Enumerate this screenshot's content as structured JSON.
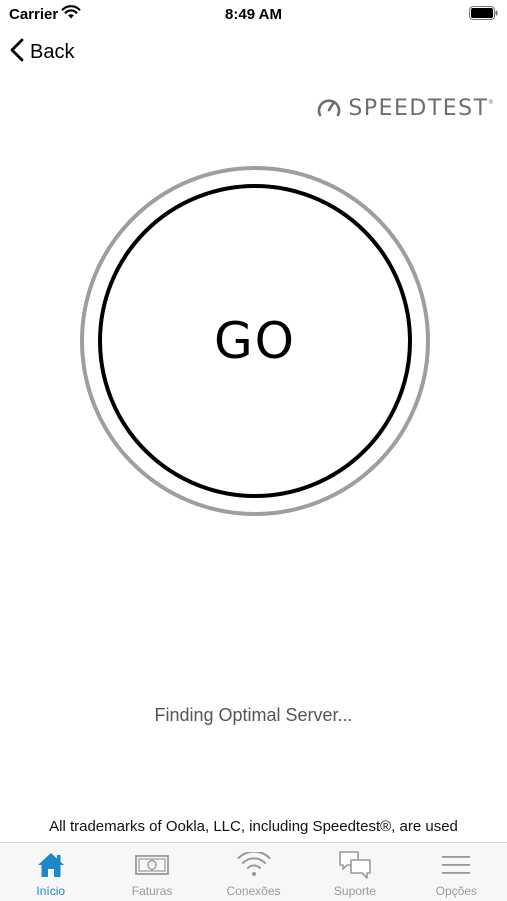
{
  "status_bar": {
    "carrier": "Carrier",
    "time": "8:49 AM"
  },
  "nav": {
    "back_label": "Back"
  },
  "brand": {
    "name": "SPEEDTEST",
    "mark": "®"
  },
  "go_button": {
    "label": "GO"
  },
  "status": {
    "text": "Finding Optimal Server..."
  },
  "footer": {
    "trademark": "All trademarks of Ookla, LLC, including Speedtest®, are used"
  },
  "tabs": [
    {
      "label": "Início",
      "icon": "home-icon",
      "active": true
    },
    {
      "label": "Faturas",
      "icon": "bill-icon",
      "active": false
    },
    {
      "label": "Conexões",
      "icon": "wifi-icon",
      "active": false
    },
    {
      "label": "Suporte",
      "icon": "chat-icon",
      "active": false
    },
    {
      "label": "Opções",
      "icon": "menu-icon",
      "active": false
    }
  ],
  "colors": {
    "active_tab": "#1d8ac7",
    "inactive_tab": "#9a9a9a",
    "outer_ring": "#9e9e9e",
    "brand": "#6e6e6e"
  }
}
